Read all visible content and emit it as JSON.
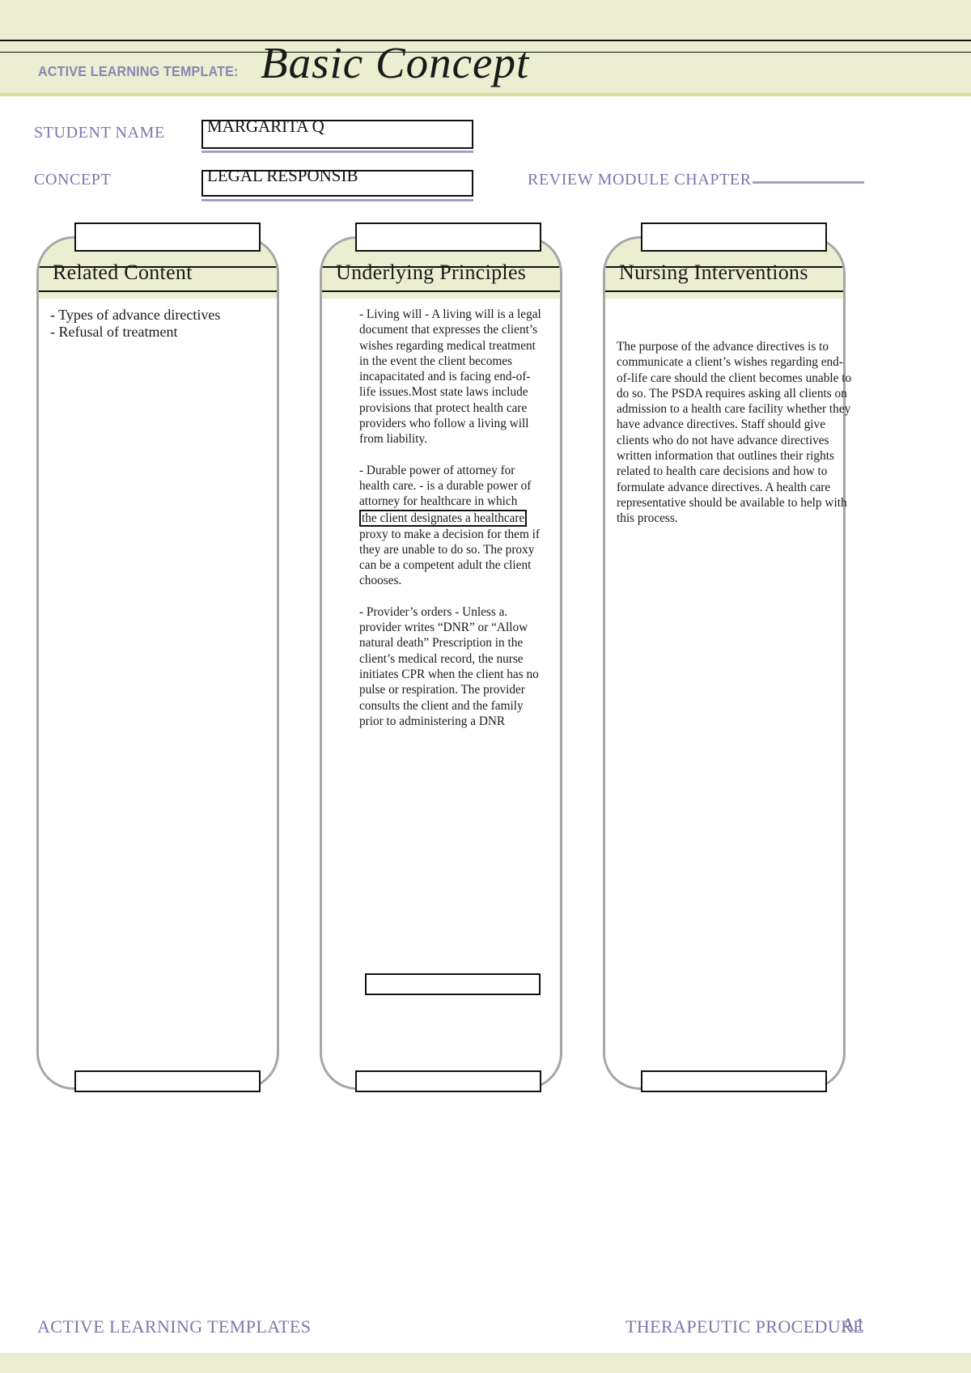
{
  "header": {
    "eyebrow": "ACTIVE LEARNING TEMPLATE:",
    "title": "Basic Concept"
  },
  "fields": {
    "student_name_label": "STUDENT NAME",
    "student_name_value": "MARGARITA Q",
    "concept_label": "CONCEPT",
    "concept_value": "LEGAL RESPONSIB",
    "review_module_label": "REVIEW MODULE CHAPTER",
    "review_module_value": ""
  },
  "columns": [
    {
      "heading": "Related Content",
      "top_box_value": "",
      "bottom_box_value": "",
      "paragraphs": [
        "- Types of advance directives\n- Refusal of treatment"
      ]
    },
    {
      "heading": "Underlying Principles",
      "top_box_value": "",
      "mid_box_value": "",
      "bottom_box_value": "",
      "paragraphs": [
        "- Living will - A living will is a legal document that expresses the client’s wishes regarding medical treatment in the event the client becomes incapacitated and is facing end-of-life issues.Most state laws include provisions that protect health care providers who follow a living will from liability.",
        "- Durable power of attorney for health care. - is a durable power of attorney for healthcare in which ",
        "the client designates a healthcare",
        " proxy to make a decision for them if they are unable to do so. The proxy can be a competent adult the client chooses.",
        "- Provider’s orders - Unless a. provider writes “DNR” or “Allow natural death” Prescription in the client’s medical record, the nurse initiates CPR when the client has no pulse or respiration. The provider consults the client and the family prior to administering a DNR"
      ]
    },
    {
      "heading": "Nursing Interventions",
      "top_box_value": "",
      "bottom_box_value": "",
      "paragraphs": [
        " The purpose of the advance directives is to communicate a client’s wishes regarding end-of-life care should the client becomes unable to do so. The PSDA requires asking all clients on admission to a health care facility whether they have advance directives. Staff should give clients who do not have advance directives written information that outlines their rights related to health care decisions and how to formulate advance directives. A health care representative should be available to help with this process."
      ]
    }
  ],
  "footer": {
    "left": "ACTIVE LEARNING TEMPLATES",
    "right": "THERAPEUTIC PROCEDURE",
    "code": "A1"
  },
  "colors": {
    "band": "#eceed1",
    "band_border": "#d9dc9c",
    "accent_text": "#7d76ad",
    "rule": "#a59ccb",
    "column_border": "#a6a6a6",
    "ink": "#1a1a1a"
  }
}
